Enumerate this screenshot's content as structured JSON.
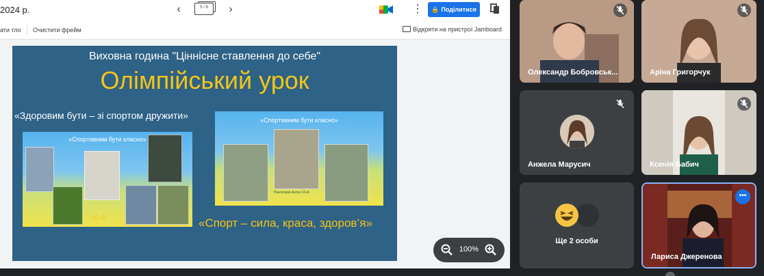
{
  "jamboard": {
    "title": "2024 р.",
    "frame_counter": "5 / 8",
    "share_label": "Поділитися",
    "toolbar": {
      "set_background": "ати тло",
      "clear_frame": "Очистити фрейм",
      "open_on_device": "Відкрити на пристрої Jamboard"
    },
    "zoom": "100%"
  },
  "slide": {
    "subtitle": "Виховна година \"Ціннісне ставлення до себе\"",
    "title": "Олімпійський урок",
    "slogan1": "«Здоровим бути – зі спортом дружити»",
    "slogan2": "«Спорт – сила, краса, здоров’я»",
    "collage1_caption": "«Спортивним  бути класно»",
    "collage1_tag": "10-А",
    "collage2_caption": "«Спортивним  бути класно»",
    "collage2_name": "Пантелєєв Антон  10-А"
  },
  "participants": [
    {
      "name": "Олександр Бобровськ...",
      "muted": true
    },
    {
      "name": "Аріна Григорчук",
      "muted": true
    },
    {
      "name": "Анжела Марусич",
      "muted": true
    },
    {
      "name": "Ксенія Бабич",
      "muted": true
    },
    {
      "name": "Лариса Джеренова",
      "muted": false,
      "active": true
    }
  ],
  "more_tile": {
    "label": "Ще 2 особи"
  },
  "colors": {
    "share_button": "#1a73e8",
    "slide_bg": "#2e6286",
    "slide_title": "#f5c518",
    "meet_bg": "#202124",
    "tile_bg": "#3c4043",
    "active_border": "#8ab4f8"
  },
  "icons": {
    "prev": "chevron-left-icon",
    "next": "chevron-right-icon",
    "menu": "more-vert-icon",
    "lock": "lock-icon",
    "zoom_out": "zoom-out-icon",
    "zoom_in": "zoom-in-icon",
    "mic_off": "mic-off-icon",
    "more_options": "more-horiz-icon"
  }
}
